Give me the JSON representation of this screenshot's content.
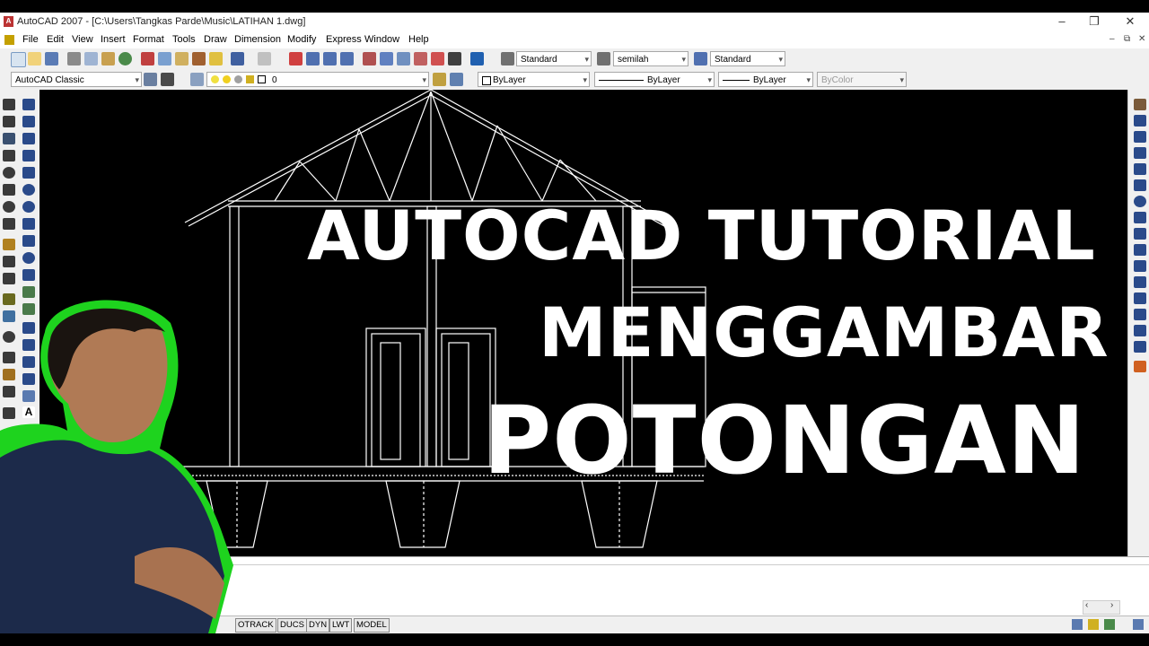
{
  "window": {
    "title": "AutoCAD 2007 - [C:\\Users\\Tangkas Parde\\Music\\LATIHAN 1.dwg]",
    "controls": [
      "–",
      "❐",
      "✕"
    ],
    "doc_controls": [
      "–",
      "⧉",
      "✕"
    ]
  },
  "menu": [
    "File",
    "Edit",
    "View",
    "Insert",
    "Format",
    "Tools",
    "Draw",
    "Dimension",
    "Modify",
    "Express",
    "Window",
    "Help"
  ],
  "styles_toolbar": {
    "text_style": "Standard",
    "dim_style": "semilah",
    "table_style": "Standard"
  },
  "workspace": "AutoCAD Classic",
  "layer": "0",
  "properties": {
    "color": "ByLayer",
    "linetype": "ByLayer",
    "lineweight": "ByLayer",
    "plotstyle": "ByColor"
  },
  "overlay": {
    "line1": "AUTOCAD TUTORIAL",
    "line2": "MENGGAMBAR",
    "line3": "POTONGAN"
  },
  "status_buttons": [
    "OTRACK",
    "DUCS",
    "DYN",
    "LWT",
    "MODEL"
  ],
  "colors": {
    "accent_green": "#1ed31e",
    "canvas": "#000000"
  }
}
